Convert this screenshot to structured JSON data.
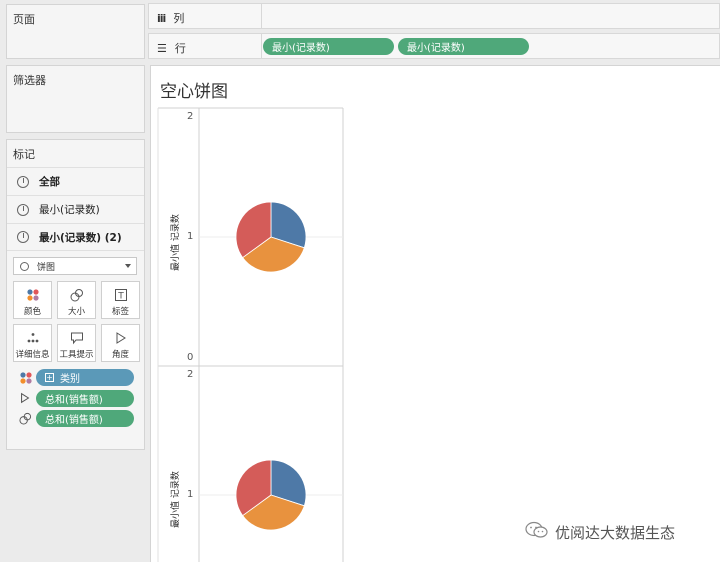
{
  "panels": {
    "pages_title": "页面",
    "filters_title": "筛选器",
    "marks_title": "标记"
  },
  "marks": {
    "rows": [
      {
        "label": "全部",
        "bold": true
      },
      {
        "label": "最小(记录数)",
        "bold": false
      },
      {
        "label": "最小(记录数) (2)",
        "bold": true
      }
    ],
    "mark_type": "饼图",
    "buttons": [
      {
        "label": "颜色",
        "icon": "color-dots-icon"
      },
      {
        "label": "大小",
        "icon": "size-icon"
      },
      {
        "label": "标签",
        "icon": "label-icon"
      },
      {
        "label": "详细信息",
        "icon": "detail-icon"
      },
      {
        "label": "工具提示",
        "icon": "tooltip-icon"
      },
      {
        "label": "角度",
        "icon": "angle-icon"
      }
    ],
    "pills": [
      {
        "label": "类别",
        "icon": "color-dots-icon"
      },
      {
        "label": "总和(销售额)",
        "icon": "angle-icon"
      },
      {
        "label": "总和(销售额)",
        "icon": "size-icon"
      }
    ]
  },
  "shelves": {
    "columns_label": "列",
    "rows_label": "行",
    "row_pills": [
      "最小(记录数)",
      "最小(记录数)"
    ]
  },
  "view": {
    "title": "空心饼图",
    "axis_title": "最小值 记录数",
    "top_ticks": [
      "2",
      "1",
      "0"
    ],
    "bottom_ticks": [
      "2",
      "1"
    ]
  },
  "colors": {
    "blue": "#4e79a7",
    "orange": "#e8923e",
    "red": "#d45c59",
    "pill_green": "#4fa87a",
    "pill_blue": "#5b99b8"
  },
  "chart_data": [
    {
      "type": "pie",
      "y": 1,
      "ylim": [
        0,
        2
      ],
      "slices": [
        {
          "color": "#4e79a7",
          "fraction": 0.3
        },
        {
          "color": "#e8923e",
          "fraction": 0.35
        },
        {
          "color": "#d45c59",
          "fraction": 0.35
        }
      ]
    },
    {
      "type": "pie",
      "y": 1,
      "ylim": [
        0,
        2
      ],
      "slices": [
        {
          "color": "#4e79a7",
          "fraction": 0.3
        },
        {
          "color": "#e8923e",
          "fraction": 0.35
        },
        {
          "color": "#d45c59",
          "fraction": 0.35
        }
      ]
    }
  ],
  "watermark": {
    "text": "优阅达大数据生态",
    "icon": "wechat-icon"
  }
}
